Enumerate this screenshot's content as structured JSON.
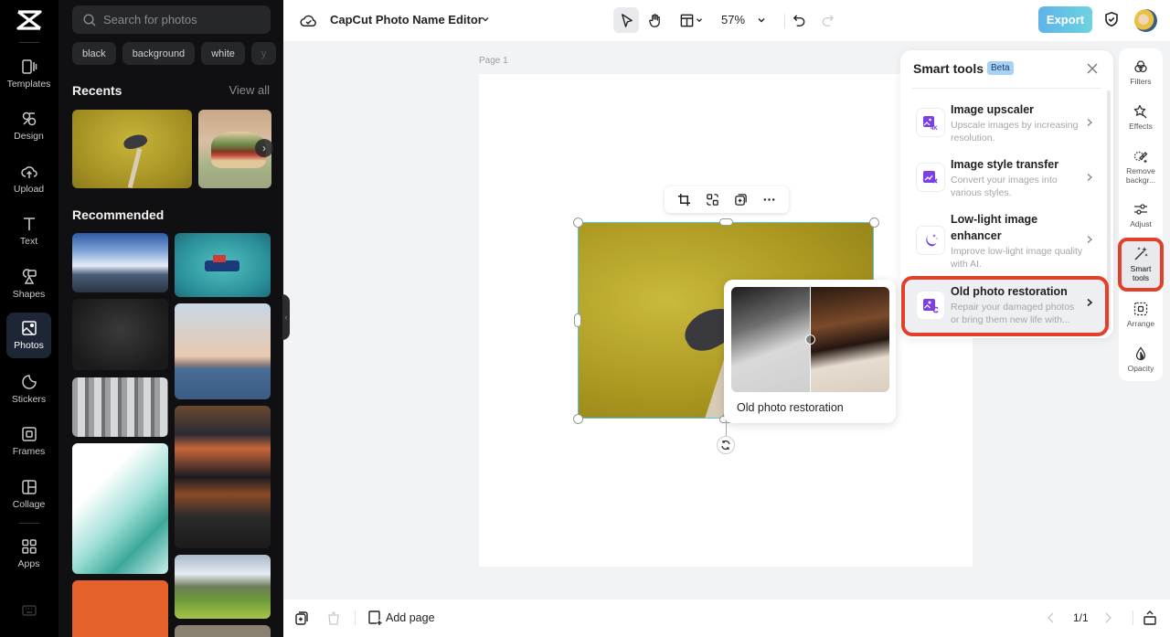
{
  "rail": {
    "items": [
      {
        "label": "Templates",
        "icon": "templates-icon"
      },
      {
        "label": "Design",
        "icon": "design-icon"
      },
      {
        "label": "Upload",
        "icon": "upload-icon"
      },
      {
        "label": "Text",
        "icon": "text-icon"
      },
      {
        "label": "Shapes",
        "icon": "shapes-icon"
      },
      {
        "label": "Photos",
        "icon": "photos-icon",
        "active": true
      },
      {
        "label": "Stickers",
        "icon": "stickers-icon"
      },
      {
        "label": "Frames",
        "icon": "frames-icon"
      },
      {
        "label": "Collage",
        "icon": "collage-icon"
      },
      {
        "label": "Apps",
        "icon": "apps-icon"
      }
    ]
  },
  "panel": {
    "search_placeholder": "Search for photos",
    "chips": [
      "black",
      "background",
      "white",
      "y"
    ],
    "recents_title": "Recents",
    "view_all": "View all",
    "recommended_title": "Recommended",
    "recents": [
      "pigeon-on-branch",
      "burger-on-plate"
    ],
    "recommended": [
      "city-skyline-clouds",
      "boat-on-sea",
      "dark-texture",
      "new-york-skyline",
      "stone-pillars",
      "ramen-meal",
      "teal-abstract-wave",
      "green-hills-village",
      "orange-background",
      "food-bowl"
    ]
  },
  "topbar": {
    "title": "CapCut Photo Name Editor",
    "zoom": "57%",
    "export_label": "Export"
  },
  "canvas": {
    "page_label": "Page 1"
  },
  "preview": {
    "caption": "Old photo restoration"
  },
  "smart_tools": {
    "title": "Smart tools",
    "badge": "Beta",
    "tools": [
      {
        "name": "Image upscaler",
        "desc": "Upscale images by increasing resolution."
      },
      {
        "name": "Image style transfer",
        "desc": "Convert your images into various styles."
      },
      {
        "name": "Low-light image enhancer",
        "desc": "Improve low-light image quality with AI."
      },
      {
        "name": "Old photo restoration",
        "desc": "Repair your damaged photos or bring them new life with...",
        "highlighted": true
      }
    ]
  },
  "right_rail": {
    "items": [
      {
        "label": "Filters"
      },
      {
        "label": "Effects"
      },
      {
        "label": "Remove backgr..."
      },
      {
        "label": "Adjust"
      },
      {
        "label": "Smart tools",
        "highlighted": true
      },
      {
        "label": "Arrange"
      },
      {
        "label": "Opacity"
      }
    ]
  },
  "bottombar": {
    "add_page": "Add page",
    "pagination": "1/1"
  },
  "colors": {
    "accent": "#54c3df",
    "highlight": "#e3402b",
    "tool_icon": "#7b3fe4"
  }
}
